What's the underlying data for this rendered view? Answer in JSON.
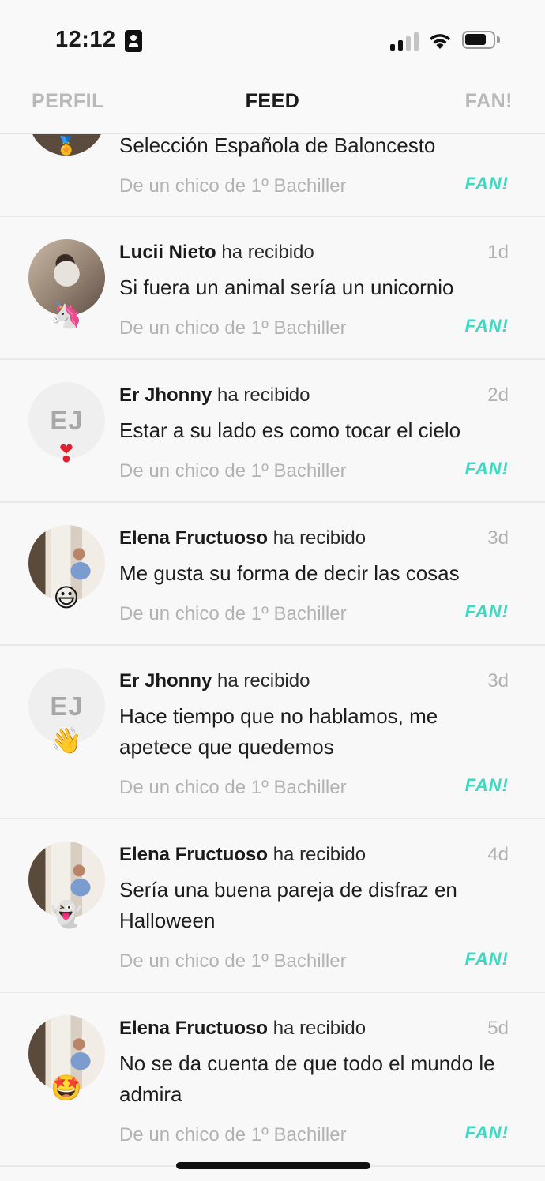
{
  "status_bar": {
    "time": "12:12",
    "colors": {
      "signal_active": "#111111",
      "signal_inactive": "#c4c4c4"
    }
  },
  "nav": {
    "left": "PERFIL",
    "center": "FEED",
    "right": "FAN!"
  },
  "feed": {
    "fan_color": "#3fd9c0",
    "partial_item": {
      "message": "Selección Española de Baloncesto",
      "sender": "De un chico de 1º Bachiller",
      "fan": "FAN!",
      "emoji": "🏅"
    },
    "items": [
      {
        "name": "Lucii Nieto",
        "action": "ha recibido",
        "time": "1d",
        "message": "Si fuera un animal sería un unicornio",
        "sender": "De un chico de 1º Bachiller",
        "fan": "FAN!",
        "emoji": "🦄",
        "avatar": "photo"
      },
      {
        "name": "Er Jhonny",
        "action": "ha recibido",
        "time": "2d",
        "message": "Estar a su lado es como tocar el cielo",
        "sender": "De un chico de 1º Bachiller",
        "fan": "FAN!",
        "emoji": "❣",
        "avatar": "initials",
        "initials": "EJ"
      },
      {
        "name": "Elena Fructuoso",
        "action": "ha recibido",
        "time": "3d",
        "message": "Me gusta su forma de decir las cosas",
        "sender": "De un chico de 1º Bachiller",
        "fan": "FAN!",
        "emoji": "😃",
        "avatar": "photo"
      },
      {
        "name": "Er Jhonny",
        "action": "ha recibido",
        "time": "3d",
        "message": "Hace tiempo que no hablamos, me apetece que quedemos",
        "sender": "De un chico de 1º Bachiller",
        "fan": "FAN!",
        "emoji": "👋",
        "avatar": "initials",
        "initials": "EJ"
      },
      {
        "name": "Elena Fructuoso",
        "action": "ha recibido",
        "time": "4d",
        "message": "Sería una buena pareja de disfraz en Halloween",
        "sender": "De un chico de 1º Bachiller",
        "fan": "FAN!",
        "emoji": "👻",
        "avatar": "photo"
      },
      {
        "name": "Elena Fructuoso",
        "action": "ha recibido",
        "time": "5d",
        "message": "No se da cuenta de que todo el mundo le admira",
        "sender": "De un chico de 1º Bachiller",
        "fan": "FAN!",
        "emoji": "🤩",
        "avatar": "photo"
      }
    ]
  }
}
